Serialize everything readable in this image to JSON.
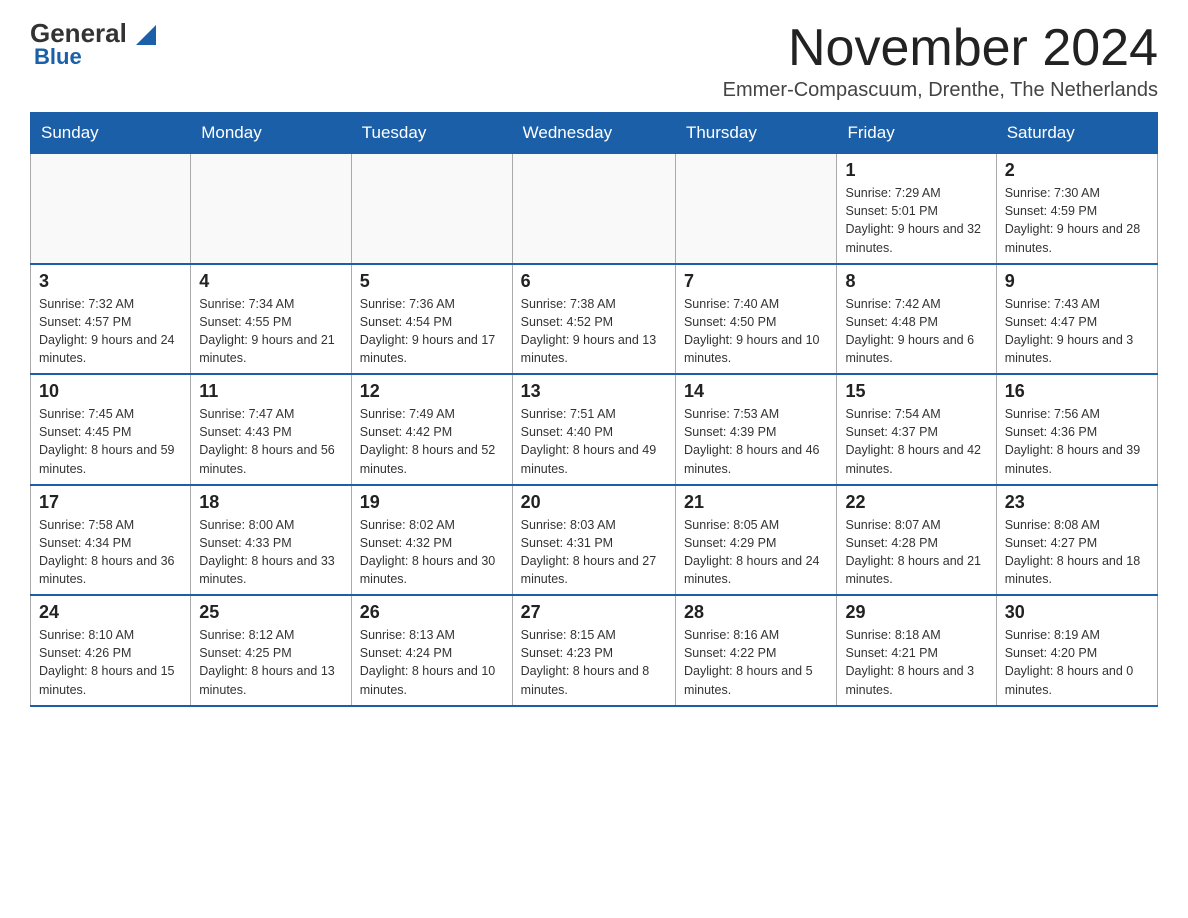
{
  "logo": {
    "general": "General",
    "blue": "Blue",
    "arrow": "▲"
  },
  "header": {
    "month_title": "November 2024",
    "location": "Emmer-Compascuum, Drenthe, The Netherlands"
  },
  "weekdays": [
    "Sunday",
    "Monday",
    "Tuesday",
    "Wednesday",
    "Thursday",
    "Friday",
    "Saturday"
  ],
  "weeks": [
    [
      {
        "day": "",
        "info": ""
      },
      {
        "day": "",
        "info": ""
      },
      {
        "day": "",
        "info": ""
      },
      {
        "day": "",
        "info": ""
      },
      {
        "day": "",
        "info": ""
      },
      {
        "day": "1",
        "info": "Sunrise: 7:29 AM\nSunset: 5:01 PM\nDaylight: 9 hours and 32 minutes."
      },
      {
        "day": "2",
        "info": "Sunrise: 7:30 AM\nSunset: 4:59 PM\nDaylight: 9 hours and 28 minutes."
      }
    ],
    [
      {
        "day": "3",
        "info": "Sunrise: 7:32 AM\nSunset: 4:57 PM\nDaylight: 9 hours and 24 minutes."
      },
      {
        "day": "4",
        "info": "Sunrise: 7:34 AM\nSunset: 4:55 PM\nDaylight: 9 hours and 21 minutes."
      },
      {
        "day": "5",
        "info": "Sunrise: 7:36 AM\nSunset: 4:54 PM\nDaylight: 9 hours and 17 minutes."
      },
      {
        "day": "6",
        "info": "Sunrise: 7:38 AM\nSunset: 4:52 PM\nDaylight: 9 hours and 13 minutes."
      },
      {
        "day": "7",
        "info": "Sunrise: 7:40 AM\nSunset: 4:50 PM\nDaylight: 9 hours and 10 minutes."
      },
      {
        "day": "8",
        "info": "Sunrise: 7:42 AM\nSunset: 4:48 PM\nDaylight: 9 hours and 6 minutes."
      },
      {
        "day": "9",
        "info": "Sunrise: 7:43 AM\nSunset: 4:47 PM\nDaylight: 9 hours and 3 minutes."
      }
    ],
    [
      {
        "day": "10",
        "info": "Sunrise: 7:45 AM\nSunset: 4:45 PM\nDaylight: 8 hours and 59 minutes."
      },
      {
        "day": "11",
        "info": "Sunrise: 7:47 AM\nSunset: 4:43 PM\nDaylight: 8 hours and 56 minutes."
      },
      {
        "day": "12",
        "info": "Sunrise: 7:49 AM\nSunset: 4:42 PM\nDaylight: 8 hours and 52 minutes."
      },
      {
        "day": "13",
        "info": "Sunrise: 7:51 AM\nSunset: 4:40 PM\nDaylight: 8 hours and 49 minutes."
      },
      {
        "day": "14",
        "info": "Sunrise: 7:53 AM\nSunset: 4:39 PM\nDaylight: 8 hours and 46 minutes."
      },
      {
        "day": "15",
        "info": "Sunrise: 7:54 AM\nSunset: 4:37 PM\nDaylight: 8 hours and 42 minutes."
      },
      {
        "day": "16",
        "info": "Sunrise: 7:56 AM\nSunset: 4:36 PM\nDaylight: 8 hours and 39 minutes."
      }
    ],
    [
      {
        "day": "17",
        "info": "Sunrise: 7:58 AM\nSunset: 4:34 PM\nDaylight: 8 hours and 36 minutes."
      },
      {
        "day": "18",
        "info": "Sunrise: 8:00 AM\nSunset: 4:33 PM\nDaylight: 8 hours and 33 minutes."
      },
      {
        "day": "19",
        "info": "Sunrise: 8:02 AM\nSunset: 4:32 PM\nDaylight: 8 hours and 30 minutes."
      },
      {
        "day": "20",
        "info": "Sunrise: 8:03 AM\nSunset: 4:31 PM\nDaylight: 8 hours and 27 minutes."
      },
      {
        "day": "21",
        "info": "Sunrise: 8:05 AM\nSunset: 4:29 PM\nDaylight: 8 hours and 24 minutes."
      },
      {
        "day": "22",
        "info": "Sunrise: 8:07 AM\nSunset: 4:28 PM\nDaylight: 8 hours and 21 minutes."
      },
      {
        "day": "23",
        "info": "Sunrise: 8:08 AM\nSunset: 4:27 PM\nDaylight: 8 hours and 18 minutes."
      }
    ],
    [
      {
        "day": "24",
        "info": "Sunrise: 8:10 AM\nSunset: 4:26 PM\nDaylight: 8 hours and 15 minutes."
      },
      {
        "day": "25",
        "info": "Sunrise: 8:12 AM\nSunset: 4:25 PM\nDaylight: 8 hours and 13 minutes."
      },
      {
        "day": "26",
        "info": "Sunrise: 8:13 AM\nSunset: 4:24 PM\nDaylight: 8 hours and 10 minutes."
      },
      {
        "day": "27",
        "info": "Sunrise: 8:15 AM\nSunset: 4:23 PM\nDaylight: 8 hours and 8 minutes."
      },
      {
        "day": "28",
        "info": "Sunrise: 8:16 AM\nSunset: 4:22 PM\nDaylight: 8 hours and 5 minutes."
      },
      {
        "day": "29",
        "info": "Sunrise: 8:18 AM\nSunset: 4:21 PM\nDaylight: 8 hours and 3 minutes."
      },
      {
        "day": "30",
        "info": "Sunrise: 8:19 AM\nSunset: 4:20 PM\nDaylight: 8 hours and 0 minutes."
      }
    ]
  ]
}
